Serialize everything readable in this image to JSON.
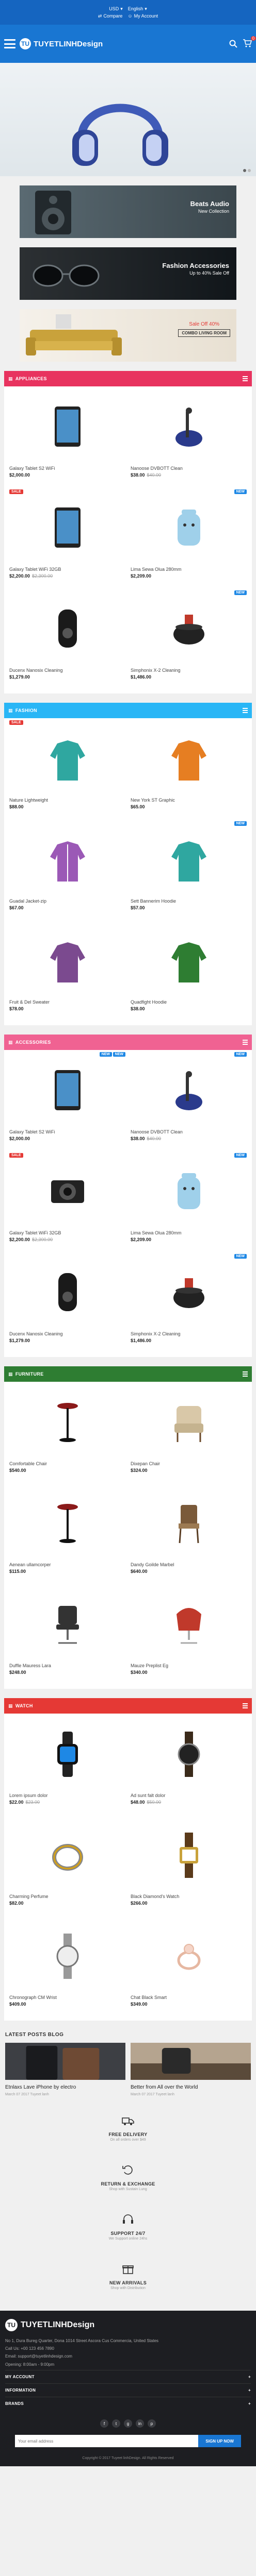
{
  "topbar": {
    "currency": "USD",
    "language": "English",
    "compare": "Compare",
    "account": "My Account"
  },
  "header": {
    "logo_initials": "TU",
    "logo_text": "TUYETLINHDesign",
    "cart_count": "0"
  },
  "slider": {
    "active_dot": 1,
    "dots": 2
  },
  "banners": [
    {
      "title": "Beats Audio",
      "subtitle": "New Collection"
    },
    {
      "title": "Fashion Accessories",
      "subtitle": "Up to 40% Sale Off"
    },
    {
      "title": "Sale Off 40%",
      "subtitle": "COMBO LIVING ROOM"
    }
  ],
  "sections": [
    {
      "title": "APPLIANCES",
      "color": "#e8335f",
      "products": [
        {
          "name": "Galaxy Tablet S2 WiFi",
          "price": "$2,000.00",
          "tags": [],
          "img": "tablet"
        },
        {
          "name": "Nanoose DVBOTT Clean",
          "price": "$38.00",
          "old": "$40.00",
          "tags": [],
          "img": "vacuum"
        },
        {
          "name": "Galaxy Tablet WiFi 32GB",
          "price": "$2,200.00",
          "old": "$2,300.00",
          "tags": [
            "SALE"
          ],
          "img": "tablet"
        },
        {
          "name": "Lima Sewa Olua 280mm",
          "price": "$2,209.00",
          "tags": [
            "NEW"
          ],
          "img": "kettle"
        },
        {
          "name": "Ducenx Nanosix Cleaning",
          "price": "$1,279.00",
          "tags": [],
          "img": "speaker"
        },
        {
          "name": "Simphonix X-2 Cleaning",
          "price": "$1,486.00",
          "tags": [
            "NEW"
          ],
          "img": "cooker"
        }
      ]
    },
    {
      "title": "FASHION",
      "color": "#29b6f6",
      "products": [
        {
          "name": "Nature Lightweight",
          "price": "$88.00",
          "tags": [
            "SALE"
          ],
          "img": "hoodie-teal"
        },
        {
          "name": "New York ST Graphic",
          "price": "$65.00",
          "tags": [],
          "img": "shirt-orange"
        },
        {
          "name": "Guadal Jacket-zip",
          "price": "$67.00",
          "tags": [],
          "img": "jacket-purple"
        },
        {
          "name": "Sett Bannerim Hoodie",
          "price": "$57.00",
          "tags": [
            "NEW"
          ],
          "img": "hoodie-teal"
        },
        {
          "name": "Fruit & Del Sweater",
          "price": "$78.00",
          "tags": [],
          "img": "hoodie-purple"
        },
        {
          "name": "Quadfight Hoodie",
          "price": "$38.00",
          "tags": [],
          "img": "hoodie-green"
        }
      ]
    },
    {
      "title": "ACCESSORIES",
      "color": "#f06292",
      "products": [
        {
          "name": "Galaxy Tablet S2 WiFi",
          "price": "$2,000.00",
          "tags": [
            "NEW",
            "NEW"
          ],
          "img": "tablet"
        },
        {
          "name": "Nanoose DVBOTT Clean",
          "price": "$38.00",
          "old": "$40.00",
          "tags": [
            "NEW"
          ],
          "img": "vacuum"
        },
        {
          "name": "Galaxy Tablet WiFi 32GB",
          "price": "$2,200.00",
          "old": "$2,300.00",
          "tags": [
            "SALE"
          ],
          "img": "camera"
        },
        {
          "name": "Lima Sewa Olua 280mm",
          "price": "$2,209.00",
          "tags": [
            "NEW"
          ],
          "img": "kettle"
        },
        {
          "name": "Ducenx Nanosix Cleaning",
          "price": "$1,279.00",
          "tags": [],
          "img": "speaker"
        },
        {
          "name": "Simphonix X-2 Cleaning",
          "price": "$1,486.00",
          "tags": [
            "NEW"
          ],
          "img": "cooker"
        }
      ]
    },
    {
      "title": "FURNITURE",
      "color": "#2e7d32",
      "products": [
        {
          "name": "Comfortable Chair",
          "price": "$540.00",
          "tags": [],
          "img": "stool"
        },
        {
          "name": "Dixepan Chair",
          "price": "$324.00",
          "tags": [],
          "img": "armchair"
        },
        {
          "name": "Aenean ullamcorper",
          "price": "$115.00",
          "tags": [],
          "img": "stool"
        },
        {
          "name": "Dandy Goilde Marbel",
          "price": "$640.00",
          "tags": [],
          "img": "sidechair"
        },
        {
          "name": "Duffle Mauress Lara",
          "price": "$248.00",
          "tags": [],
          "img": "office"
        },
        {
          "name": "Mauze Preplist Eg",
          "price": "$340.00",
          "tags": [],
          "img": "redchair"
        }
      ]
    },
    {
      "title": "WATCH",
      "color": "#e53935",
      "products": [
        {
          "name": "Lorem ipsum dolor",
          "price": "$22.00",
          "old": "$23.00",
          "tags": [],
          "img": "smartwatch"
        },
        {
          "name": "Ad sunt falt dolor",
          "price": "$48.00",
          "old": "$50.00",
          "tags": [],
          "img": "watch-dark"
        },
        {
          "name": "Charming Perfume",
          "price": "$82.00",
          "tags": [],
          "img": "ring"
        },
        {
          "name": "Black Diamond's Watch",
          "price": "$266.00",
          "tags": [],
          "img": "watch-gold"
        },
        {
          "name": "Chronograph CM Wrist",
          "price": "$409.00",
          "tags": [],
          "img": "watch-silver"
        },
        {
          "name": "Chat Black Smart",
          "price": "$349.00",
          "tags": [],
          "img": "ring-pink"
        }
      ]
    }
  ],
  "blog": {
    "heading": "LATEST POSTS BLOG",
    "posts": [
      {
        "title": "Etnlaxs Lave iPhone by electro",
        "date": "March 07 2017 Tuyeet lanh"
      },
      {
        "title": "Better from All over the World",
        "date": "March 07 2017 Tuyeet lanh"
      }
    ]
  },
  "services": [
    {
      "title": "FREE DELIVERY",
      "subtitle": "On all orders over $49",
      "icon": "truck-icon"
    },
    {
      "title": "RETURN & EXCHANGE",
      "subtitle": "Shop with Sustain Lung",
      "icon": "return-icon"
    },
    {
      "title": "SUPPORT 24/7",
      "subtitle": "We Support online 24hs",
      "icon": "support-icon"
    },
    {
      "title": "NEW ARRIVALS",
      "subtitle": "Shop with Distribution",
      "icon": "gift-icon"
    }
  ],
  "footer": {
    "logo_initials": "TU",
    "logo_text": "TUYETLINHDesign",
    "address": "No 1, Dura Bureg Quarter, Dona 1014 Street Ascora Cus Commercia, United States",
    "phone": "Call Us: +00 123 456 7890",
    "email": "Email: support@tuyetlinhdesign.com",
    "hours": "Opening: 8:00am - 9:00pm",
    "sections": [
      "MY ACCOUNT",
      "INFORMATION",
      "BRANDS"
    ],
    "social": [
      "f",
      "t",
      "g",
      "in",
      "p"
    ],
    "news_placeholder": "Your email address",
    "news_button": "SIGN UP NOW",
    "copyright": "Copyright © 2017 Tuyeet linhDesign. All Rights Reserved"
  }
}
